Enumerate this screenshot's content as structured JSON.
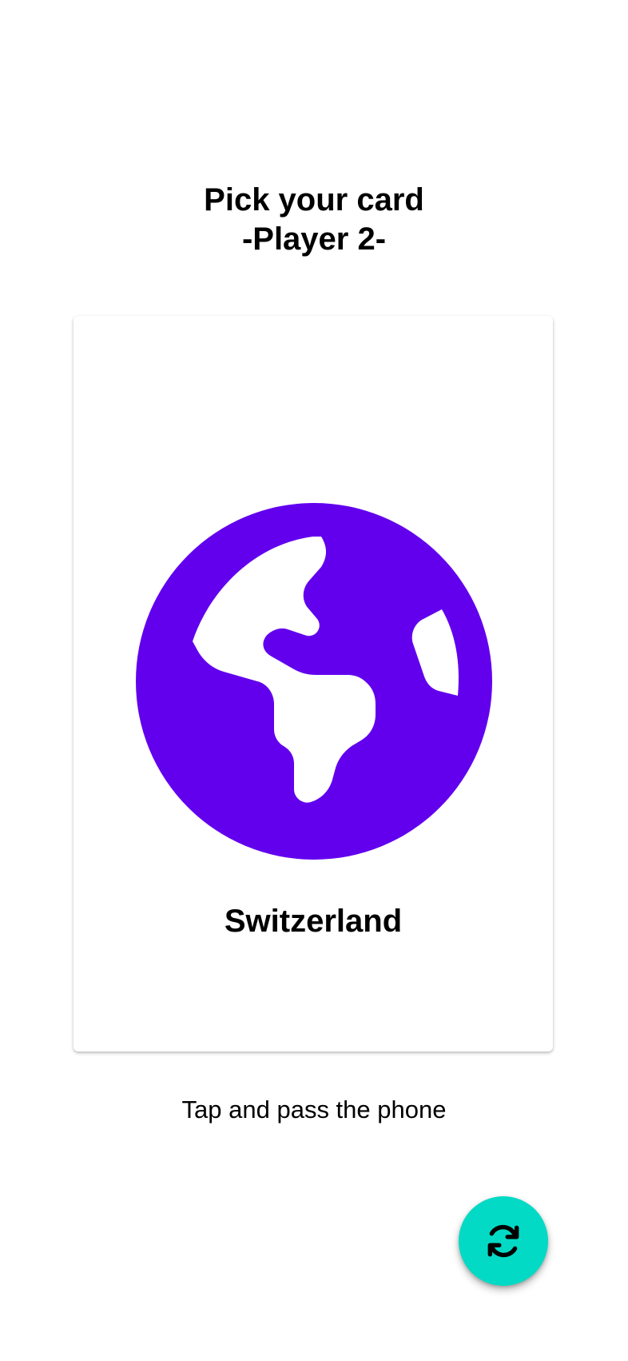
{
  "header": {
    "title_line1": "Pick your card",
    "title_line2": "-Player 2-"
  },
  "card": {
    "icon": "globe-icon",
    "icon_color": "#6200EE",
    "country": "Switzerland"
  },
  "hint": "Tap and pass the phone",
  "fab": {
    "icon": "refresh-icon",
    "color": "#03DAC5"
  }
}
